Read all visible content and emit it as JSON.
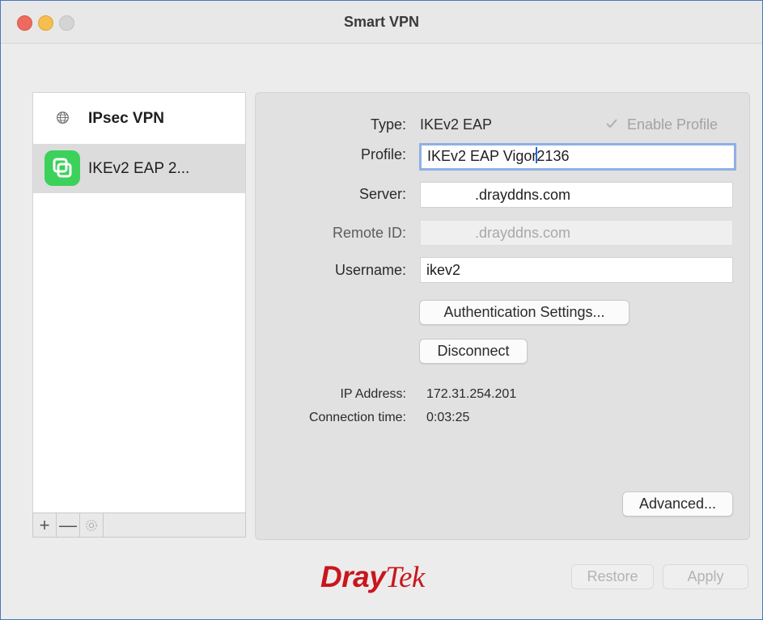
{
  "window": {
    "title": "Smart VPN"
  },
  "sidebar": {
    "header_label": "IPsec VPN",
    "items": [
      {
        "label": "IKEv2 EAP 2..."
      }
    ],
    "toolbar": {
      "add": "+",
      "remove": "—"
    }
  },
  "form": {
    "type_label": "Type:",
    "type_value": "IKEv2 EAP",
    "enable_profile_label": "Enable Profile",
    "enable_profile_checked": true,
    "profile_label": "Profile:",
    "profile_value_before_caret": "IKEv2 EAP Vigor",
    "profile_value_after_caret": "2136",
    "server_label": "Server:",
    "server_value": ".drayddns.com",
    "remote_id_label": "Remote ID:",
    "remote_id_value": ".drayddns.com",
    "username_label": "Username:",
    "username_value": "ikev2",
    "auth_settings_button": "Authentication Settings...",
    "disconnect_button": "Disconnect"
  },
  "status": {
    "ip_label": "IP Address:",
    "ip_value": "172.31.254.201",
    "connection_time_label": "Connection time:",
    "connection_time_value": "0:03:25"
  },
  "buttons": {
    "advanced": "Advanced...",
    "restore": "Restore",
    "apply": "Apply"
  },
  "brand": {
    "part1": "Dray",
    "part2": "Tek",
    "color": "#c8161d"
  },
  "colors": {
    "accent_green": "#3bd15a",
    "focus_ring": "#8eb0e6"
  }
}
